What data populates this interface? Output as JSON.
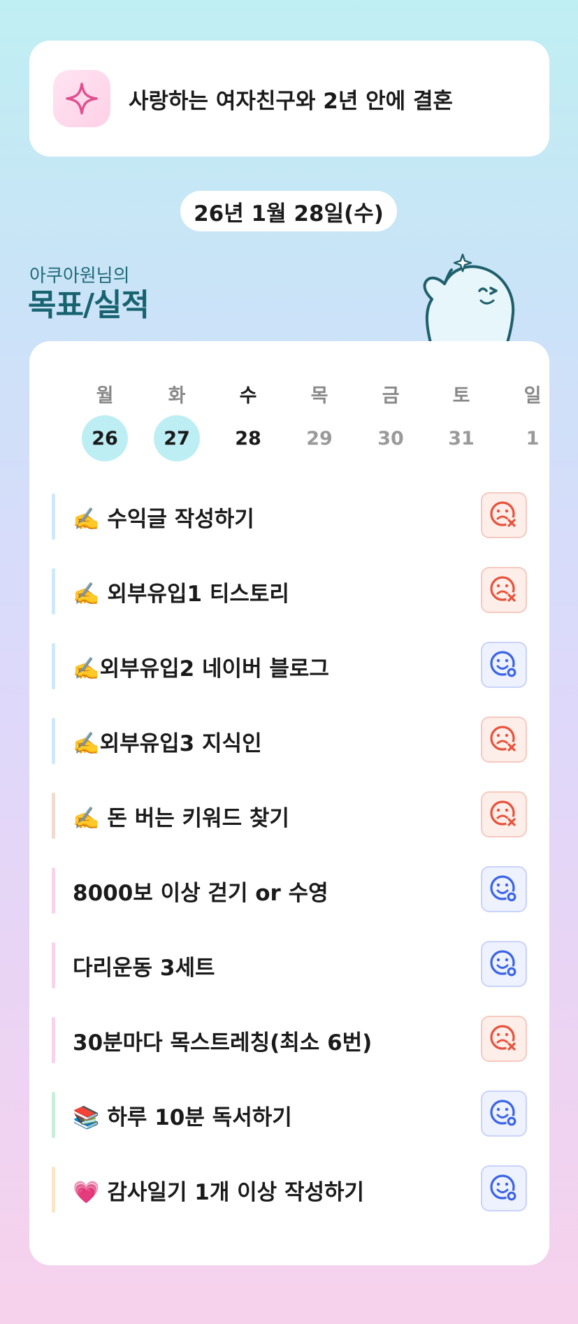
{
  "goal": {
    "icon": "sparkle-icon",
    "text": "사랑하는 여자친구와 2년 안에 결혼"
  },
  "date": "26년 1월 28일(수)",
  "owner": {
    "subtitle": "아쿠아원님의",
    "title": "목표/실적"
  },
  "week": {
    "days": [
      {
        "label": "월",
        "num": "26",
        "state": "done"
      },
      {
        "label": "화",
        "num": "27",
        "state": "done"
      },
      {
        "label": "수",
        "num": "28",
        "state": "today"
      },
      {
        "label": "목",
        "num": "29",
        "state": "future"
      },
      {
        "label": "금",
        "num": "30",
        "state": "future"
      },
      {
        "label": "토",
        "num": "31",
        "state": "future"
      },
      {
        "label": "일",
        "num": "1",
        "state": "future"
      }
    ]
  },
  "tasks": [
    {
      "label": "✍️ 수익글 작성하기",
      "status": "fail",
      "bar": "#cfe9fb"
    },
    {
      "label": "✍️ 외부유입1 티스토리",
      "status": "fail",
      "bar": "#cfe9fb"
    },
    {
      "label": "✍️외부유입2 네이버 블로그",
      "status": "ok",
      "bar": "#cfe9fb"
    },
    {
      "label": "✍️외부유입3 지식인",
      "status": "fail",
      "bar": "#cfe9fb"
    },
    {
      "label": "✍️ 돈 버는 키워드 찾기",
      "status": "fail",
      "bar": "#f4d9cf"
    },
    {
      "label": "8000보 이상 걷기 or 수영",
      "status": "ok",
      "bar": "#f9d3ea"
    },
    {
      "label": "다리운동 3세트",
      "status": "ok",
      "bar": "#f9d3ea"
    },
    {
      "label": "30분마다 목스트레칭(최소 6번)",
      "status": "fail",
      "bar": "#f9d3ea"
    },
    {
      "label": "📚 하루 10분 독서하기",
      "status": "ok",
      "bar": "#c9efd9"
    },
    {
      "label": "💗 감사일기 1개 이상 작성하기",
      "status": "ok",
      "bar": "#fbe6c6"
    }
  ],
  "colors": {
    "fail": "#e8523a",
    "ok": "#3a63e8",
    "accent": "#17636f"
  }
}
